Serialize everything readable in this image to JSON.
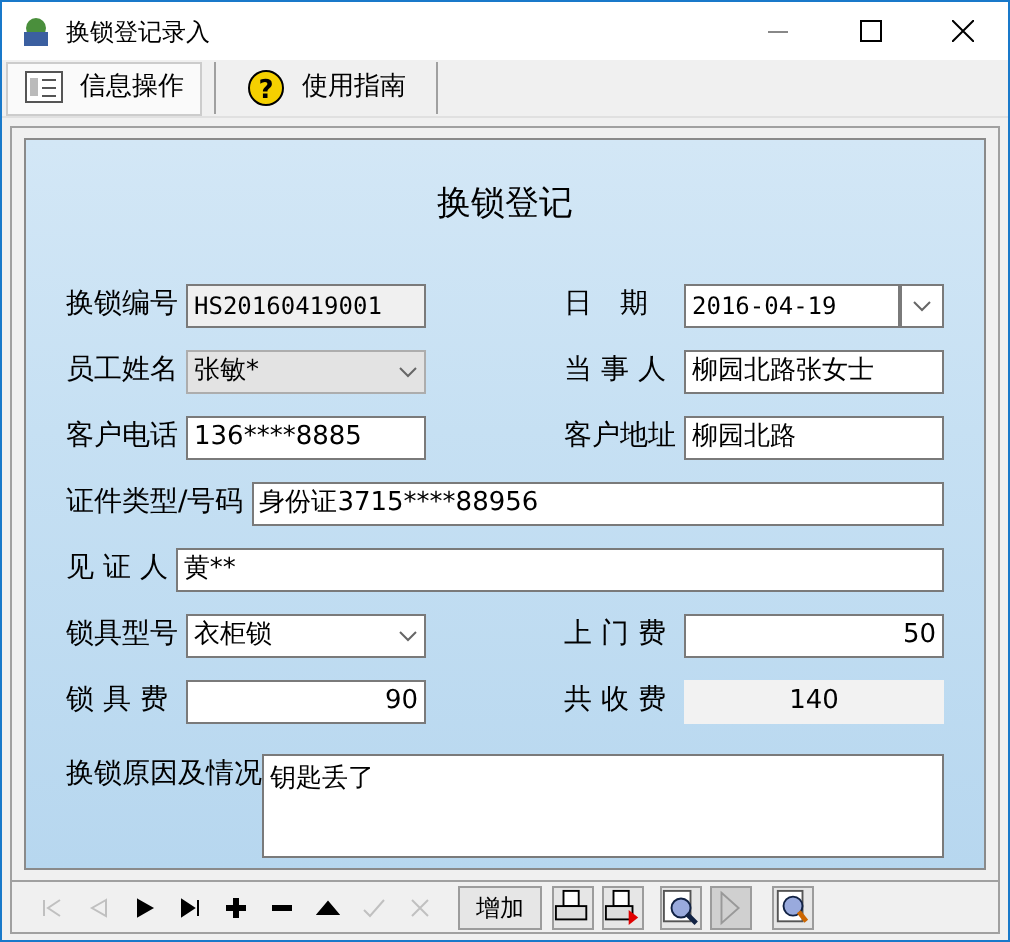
{
  "window": {
    "title": "换锁登记录入"
  },
  "toolbar": [
    {
      "kind": "info",
      "label": "信息操作",
      "selected": true
    },
    {
      "kind": "help",
      "icon": "?",
      "label": "使用指南",
      "selected": false
    }
  ],
  "form": {
    "title": "换锁登记",
    "rows": [
      [
        {
          "label": "换锁编号",
          "value": "HS20160419001",
          "kind": "readonly"
        },
        {
          "label": "日　期",
          "value": "2016-04-19",
          "kind": "date"
        }
      ],
      [
        {
          "label": "员工姓名",
          "value": "张敏*",
          "kind": "select",
          "disabled": true
        },
        {
          "label": "当 事 人",
          "value": "柳园北路张女士",
          "kind": "text"
        }
      ],
      [
        {
          "label": "客户电话",
          "value": "136****8885",
          "kind": "text"
        },
        {
          "label": "客户地址",
          "value": "柳园北路",
          "kind": "text"
        }
      ],
      [
        {
          "label": "证件类型/号码",
          "value": "身份证3715****88956",
          "kind": "wide"
        }
      ],
      [
        {
          "label": "见 证 人",
          "value": "黄**",
          "kind": "wide"
        }
      ],
      [
        {
          "label": "锁具型号",
          "value": "衣柜锁",
          "kind": "select",
          "disabled": false
        },
        {
          "label": "上 门 费",
          "value": "50",
          "kind": "number"
        }
      ],
      [
        {
          "label": "锁 具 费",
          "value": "90",
          "kind": "number"
        },
        {
          "label": "共 收 费",
          "value": "140",
          "kind": "total"
        }
      ]
    ],
    "memo": {
      "label": "换锁原因及情况",
      "value": "钥匙丢了"
    }
  },
  "navigator": [
    {
      "kind": "first",
      "disabled": true
    },
    {
      "kind": "prev",
      "disabled": true
    },
    {
      "kind": "next",
      "disabled": false
    },
    {
      "kind": "last",
      "disabled": false
    },
    {
      "kind": "add",
      "disabled": false
    },
    {
      "kind": "remove",
      "disabled": false
    },
    {
      "kind": "up",
      "disabled": false
    },
    {
      "kind": "post",
      "disabled": true
    },
    {
      "kind": "cancel",
      "disabled": true
    }
  ],
  "actions": [
    {
      "kind": "text",
      "label": "增加",
      "disabled": false
    },
    {
      "kind": "print",
      "disabled": false
    },
    {
      "kind": "print-red",
      "disabled": false
    },
    {
      "kind": "preview",
      "disabled": false
    },
    {
      "kind": "play",
      "disabled": true
    },
    {
      "kind": "search",
      "disabled": false
    }
  ]
}
